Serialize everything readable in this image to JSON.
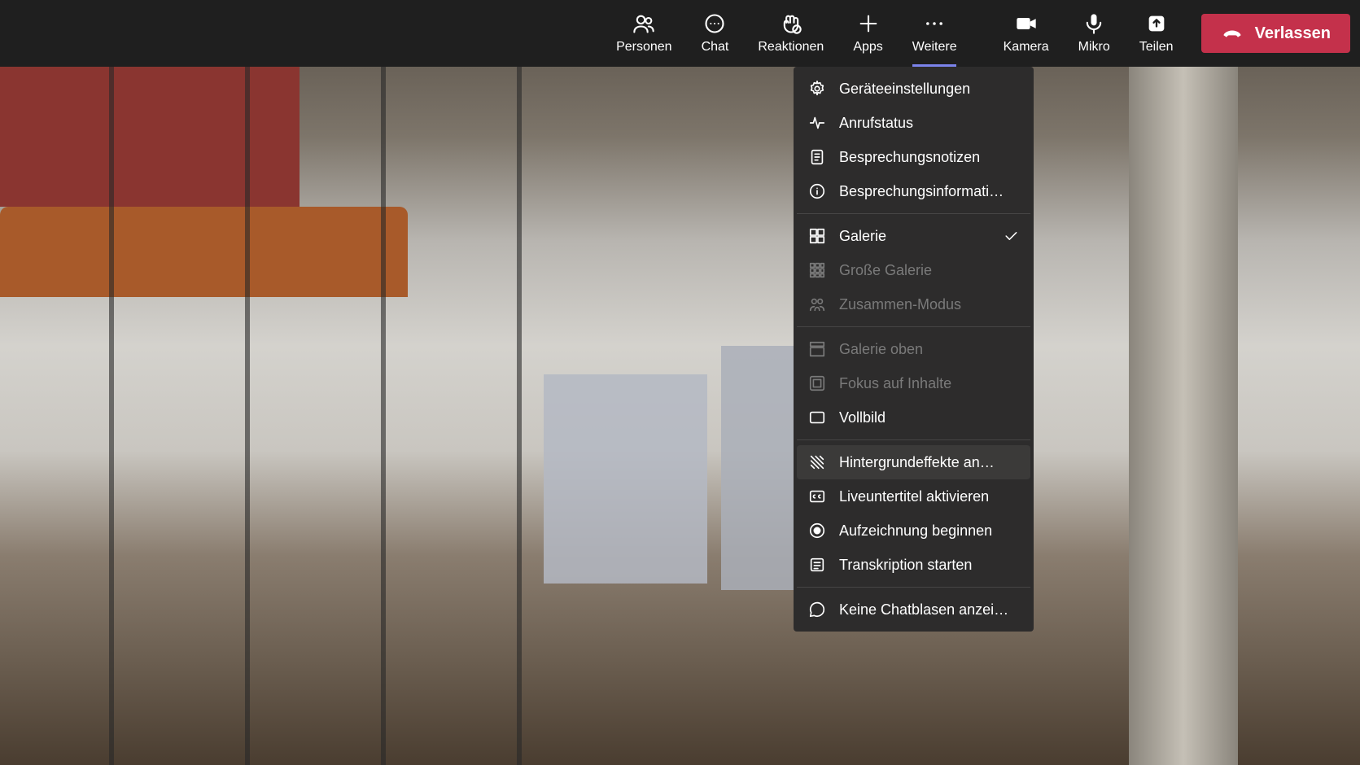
{
  "toolbar": {
    "people": "Personen",
    "chat": "Chat",
    "reactions": "Reaktionen",
    "apps": "Apps",
    "more": "Weitere",
    "camera": "Kamera",
    "mic": "Mikro",
    "share": "Teilen",
    "leave": "Verlassen"
  },
  "menu": {
    "group1": [
      {
        "key": "device-settings",
        "label": "Geräteeinstellungen",
        "icon": "gear-icon"
      },
      {
        "key": "call-health",
        "label": "Anrufstatus",
        "icon": "pulse-icon"
      },
      {
        "key": "meeting-notes",
        "label": "Besprechungsnotizen",
        "icon": "notes-icon"
      },
      {
        "key": "meeting-info",
        "label": "Besprechungsinformati…",
        "icon": "info-icon"
      }
    ],
    "group2": [
      {
        "key": "gallery",
        "label": "Galerie",
        "icon": "grid-icon",
        "checked": true
      },
      {
        "key": "large-gallery",
        "label": "Große Galerie",
        "icon": "grid-large-icon",
        "disabled": true
      },
      {
        "key": "together-mode",
        "label": "Zusammen-Modus",
        "icon": "together-icon",
        "disabled": true
      }
    ],
    "group3": [
      {
        "key": "gallery-top",
        "label": "Galerie oben",
        "icon": "gallery-top-icon",
        "disabled": true
      },
      {
        "key": "focus-content",
        "label": "Fokus auf Inhalte",
        "icon": "focus-icon",
        "disabled": true
      },
      {
        "key": "fullscreen",
        "label": "Vollbild",
        "icon": "fullscreen-icon"
      }
    ],
    "group4": [
      {
        "key": "background-effects",
        "label": "Hintergrundeffekte an…",
        "icon": "background-icon",
        "hover": true
      },
      {
        "key": "live-captions",
        "label": "Liveuntertitel aktivieren",
        "icon": "cc-icon"
      },
      {
        "key": "start-recording",
        "label": "Aufzeichnung beginnen",
        "icon": "record-icon"
      },
      {
        "key": "start-transcription",
        "label": "Transkription starten",
        "icon": "transcript-icon"
      }
    ],
    "group5": [
      {
        "key": "no-chat-bubbles",
        "label": "Keine Chatblasen anzei…",
        "icon": "chat-off-icon"
      }
    ]
  }
}
